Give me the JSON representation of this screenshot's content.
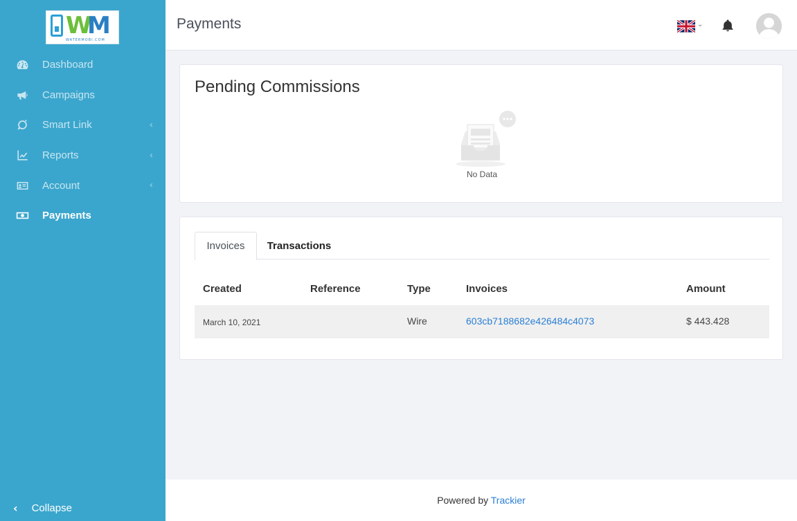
{
  "logo": {
    "letters_left": "W",
    "letters_right": "M",
    "subtitle": "WATERMOBI.COM"
  },
  "sidebar": {
    "items": [
      {
        "label": "Dashboard",
        "icon": "dashboard-icon",
        "has_chevron": false
      },
      {
        "label": "Campaigns",
        "icon": "megaphone-icon",
        "has_chevron": false
      },
      {
        "label": "Smart Link",
        "icon": "link-icon",
        "has_chevron": true
      },
      {
        "label": "Reports",
        "icon": "chart-line-icon",
        "has_chevron": true
      },
      {
        "label": "Account",
        "icon": "id-card-icon",
        "has_chevron": true
      },
      {
        "label": "Payments",
        "icon": "money-bill-icon",
        "active": true
      }
    ],
    "chevron_glyph": "‹",
    "collapse": {
      "icon_glyph": "‹",
      "label": "Collapse"
    }
  },
  "header": {
    "title": "Payments",
    "language_flag": "uk-flag-icon",
    "flag_chevron": "⌄"
  },
  "pending": {
    "title": "Pending Commissions",
    "empty_text": "No Data"
  },
  "tabs": [
    {
      "label": "Invoices",
      "active": true
    },
    {
      "label": "Transactions",
      "active": false
    }
  ],
  "table": {
    "headers": [
      "Created",
      "Reference",
      "Type",
      "Invoices",
      "Amount"
    ],
    "rows": [
      {
        "created": "March 10, 2021",
        "reference": "",
        "type": "Wire",
        "invoice": "603cb7188682e426484c4073",
        "amount": "$ 443.428"
      }
    ]
  },
  "footer": {
    "prefix": "Powered by ",
    "link": "Trackier"
  },
  "colors": {
    "sidebar": "#3ba6cd",
    "link": "#2a7fd4",
    "background": "#f2f3f7"
  }
}
